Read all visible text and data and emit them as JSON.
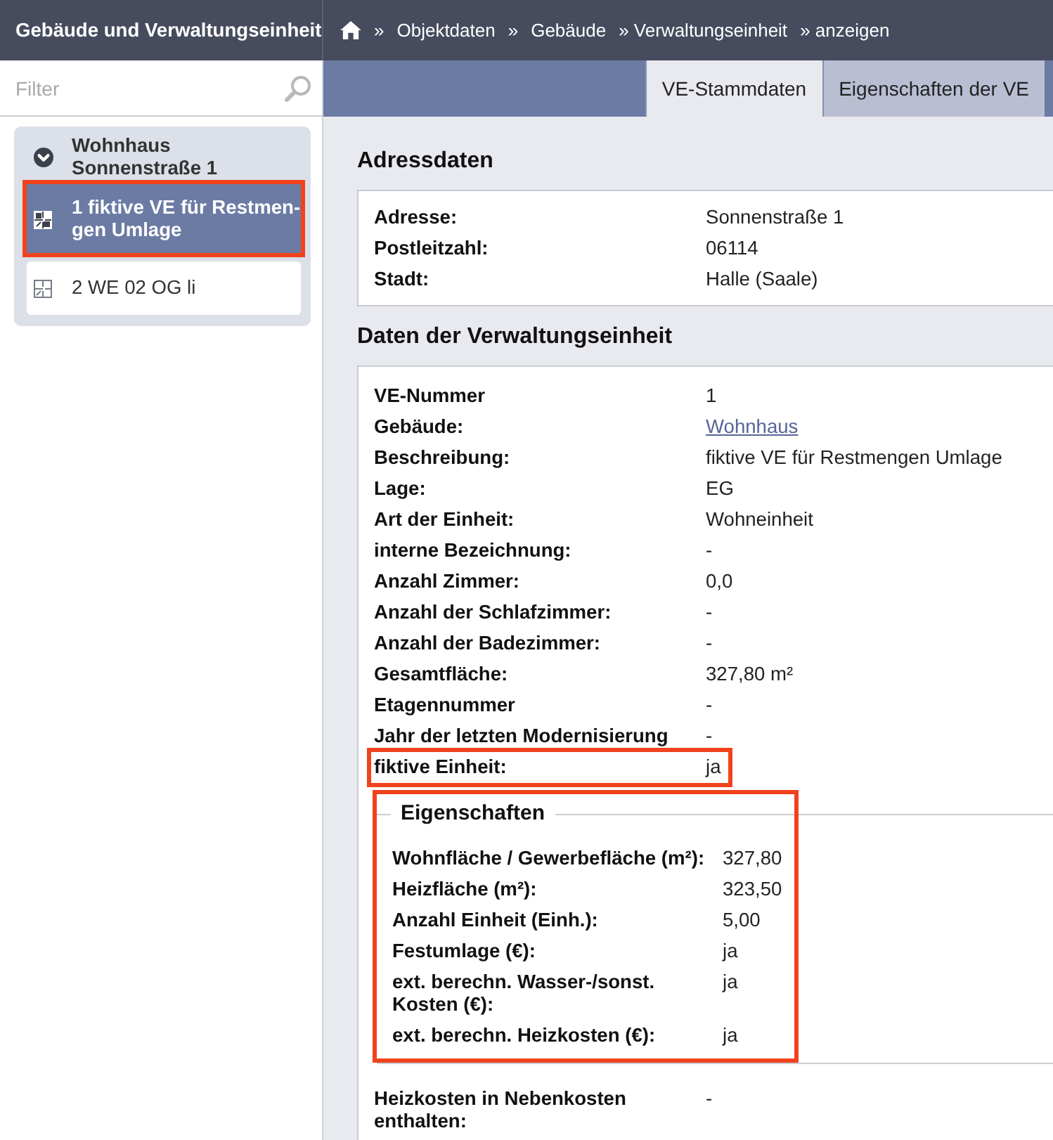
{
  "app_title": "Gebäude und Verwaltungseinheit",
  "breadcrumb": [
    {
      "separator": "»",
      "label": "Objektdaten"
    },
    {
      "separator": "»",
      "label": "Gebäude"
    },
    {
      "label": "» Verwaltungseinheit"
    },
    {
      "label": "» anzeigen"
    }
  ],
  "filter": {
    "placeholder": "Filter"
  },
  "tabs": [
    {
      "label": "VE-Stammdaten",
      "selected": true
    },
    {
      "label": "Eigenschaften der VE",
      "selected": false
    }
  ],
  "tree": {
    "label": "Wohnhaus Sonnenstraße 1",
    "expanded": true,
    "children": [
      {
        "label": "1 fiktive VE für Restmen-gen Umlage",
        "selected": true,
        "highlighted": true
      },
      {
        "label": "2 WE 02 OG li",
        "selected": false,
        "highlighted": false
      }
    ]
  },
  "address_section": {
    "title": "Adressdaten",
    "fields": [
      {
        "label": "Adresse:",
        "value": "Sonnenstraße 1"
      },
      {
        "label": "Postleitzahl:",
        "value": "06114"
      },
      {
        "label": "Stadt:",
        "value": "Halle (Saale)"
      }
    ]
  },
  "unit_section": {
    "title": "Daten der Verwaltungseinheit",
    "fields": [
      {
        "label": "VE-Nummer",
        "value": "1",
        "kind": "text",
        "highlighted": false
      },
      {
        "label": "Gebäude:",
        "value": "Wohnhaus",
        "kind": "link",
        "highlighted": false
      },
      {
        "label": "Beschreibung:",
        "value": "fiktive VE für Restmengen Umlage",
        "kind": "text",
        "highlighted": false
      },
      {
        "label": "Lage:",
        "value": "EG",
        "kind": "text",
        "highlighted": false
      },
      {
        "label": "Art der Einheit:",
        "value": "Wohneinheit",
        "kind": "text",
        "highlighted": false
      },
      {
        "label": "interne Bezeichnung:",
        "value": "-",
        "kind": "text",
        "highlighted": false
      },
      {
        "label": "Anzahl Zimmer:",
        "value": "0,0",
        "kind": "text",
        "highlighted": false
      },
      {
        "label": "Anzahl der Schlafzimmer:",
        "value": "-",
        "kind": "text",
        "highlighted": false
      },
      {
        "label": "Anzahl der Badezimmer:",
        "value": "-",
        "kind": "text",
        "highlighted": false
      },
      {
        "label": "Gesamtfläche:",
        "value": "327,80 m²",
        "kind": "text",
        "highlighted": false
      },
      {
        "label": "Etagennummer",
        "value": "-",
        "kind": "text",
        "highlighted": false
      },
      {
        "label": "Jahr der letzten Modernisierung",
        "value": "-",
        "kind": "text",
        "highlighted": false
      },
      {
        "label": "fiktive Einheit:",
        "value": "ja",
        "kind": "text",
        "highlighted": true
      }
    ],
    "properties": {
      "legend": "Eigenschaften",
      "highlighted": true,
      "fields": [
        {
          "label": "Wohnfläche / Gewerbefläche (m²):",
          "value": "327,80"
        },
        {
          "label": "Heizfläche (m²):",
          "value": "323,50"
        },
        {
          "label": "Anzahl Einheit (Einh.):",
          "value": "5,00"
        },
        {
          "label": "Festumlage (€):",
          "value": "ja"
        },
        {
          "label": "ext. berechn. Wasser-/sonst. Kosten (€):",
          "value": "ja"
        },
        {
          "label": "ext. berechn. Heizkosten (€):",
          "value": "ja"
        }
      ]
    },
    "more_fields": [
      {
        "label": "Heizkosten in Nebenkosten enthalten:",
        "value": "-"
      }
    ]
  }
}
